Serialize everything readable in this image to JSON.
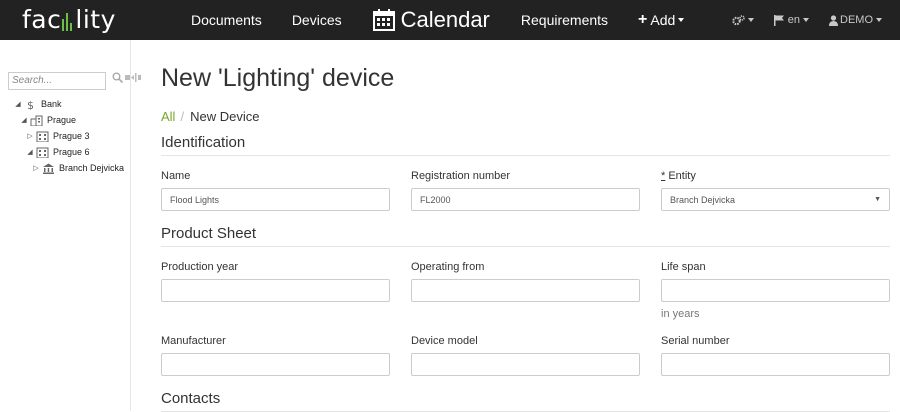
{
  "navbar": {
    "logo_text_left": "fac",
    "logo_text_right": "lity",
    "links": {
      "documents": "Documents",
      "devices": "Devices",
      "calendar": "Calendar",
      "requirements": "Requirements",
      "add": "Add"
    },
    "settings_icon": "cogs-icon",
    "language": "en",
    "user": "DEMO"
  },
  "sidebar": {
    "search_placeholder": "Search...",
    "tree": [
      {
        "label": "Bank",
        "icon": "dollar-icon",
        "toggle": "◢"
      },
      {
        "label": "Prague",
        "icon": "city-icon",
        "toggle": "◢"
      },
      {
        "label": "Prague 3",
        "icon": "building-icon",
        "toggle": "▷"
      },
      {
        "label": "Prague 6",
        "icon": "building-icon",
        "toggle": "◢"
      },
      {
        "label": "Branch Dejvicka",
        "icon": "bank-icon",
        "toggle": "▷"
      }
    ]
  },
  "main": {
    "title": "New 'Lighting' device",
    "breadcrumb": {
      "all": "All",
      "sep": "/",
      "current": "New Device"
    },
    "sections": {
      "identification": "Identification",
      "product_sheet": "Product Sheet",
      "contacts": "Contacts"
    },
    "fields": {
      "name": {
        "label": "Name",
        "value": "Flood Lights"
      },
      "registration_number": {
        "label": "Registration number",
        "value": "FL2000"
      },
      "entity": {
        "required_mark": "*",
        "label": "Entity",
        "value": "Branch Dejvicka"
      },
      "production_year": {
        "label": "Production year",
        "value": ""
      },
      "operating_from": {
        "label": "Operating from",
        "value": ""
      },
      "life_span": {
        "label": "Life span",
        "value": "",
        "help": "in years"
      },
      "manufacturer": {
        "label": "Manufacturer",
        "value": ""
      },
      "device_model": {
        "label": "Device model",
        "value": ""
      },
      "serial_number": {
        "label": "Serial number",
        "value": ""
      }
    }
  },
  "colors": {
    "navbar": "#222222",
    "link_green": "#7aa52c",
    "logo_accent": "#6dbf4b"
  }
}
